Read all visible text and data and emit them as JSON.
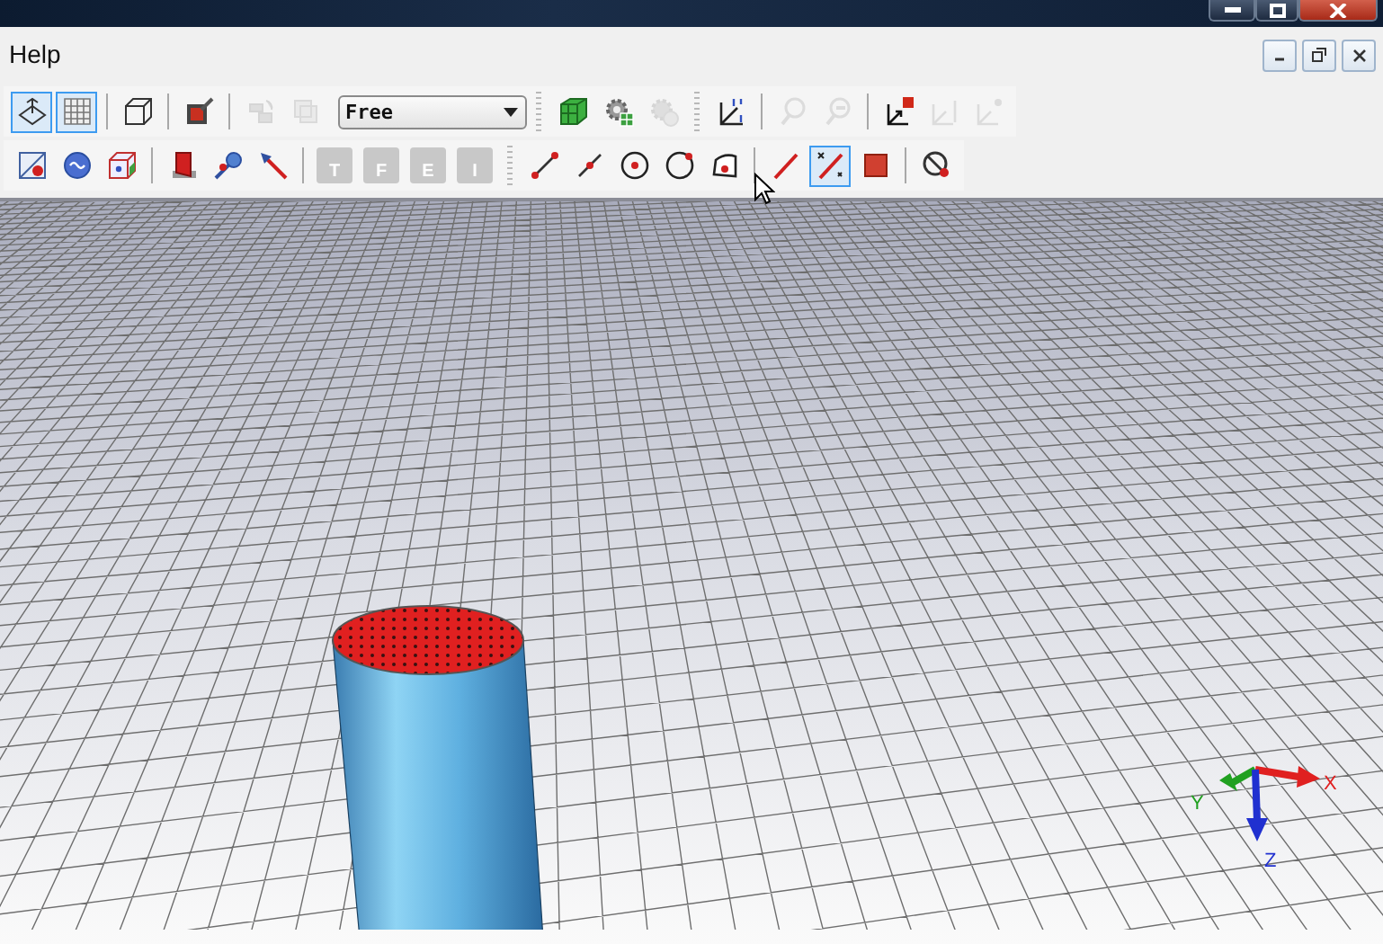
{
  "menu": [
    {
      "label": "Help"
    }
  ],
  "toolbars": [
    {
      "groups": [
        {
          "items": [
            {
              "kind": "workplane",
              "selected": true,
              "disabled": false
            },
            {
              "kind": "grid",
              "selected": true,
              "disabled": false
            }
          ]
        },
        {
          "items": [
            {
              "kind": "wire-cube",
              "selected": false,
              "disabled": false
            }
          ]
        },
        {
          "items": [
            {
              "kind": "paint",
              "selected": false,
              "disabled": false
            }
          ]
        },
        {
          "items": [
            {
              "kind": "transform",
              "selected": false,
              "disabled": true
            },
            {
              "kind": "copy",
              "selected": false,
              "disabled": true
            },
            {
              "kind": "dropdown",
              "value": "Free"
            }
          ]
        },
        {
          "grip": true,
          "items": [
            {
              "kind": "green-cube",
              "selected": false,
              "disabled": false
            },
            {
              "kind": "gear-grid",
              "selected": false,
              "disabled": false
            },
            {
              "kind": "gear-refresh",
              "selected": false,
              "disabled": true
            }
          ]
        },
        {
          "grip": true,
          "items": [
            {
              "kind": "axis-frame",
              "selected": false,
              "disabled": false
            }
          ]
        },
        {
          "items": [
            {
              "kind": "zoom-back",
              "selected": false,
              "disabled": true
            },
            {
              "kind": "zoom-forward",
              "selected": false,
              "disabled": true
            }
          ]
        },
        {
          "items": [
            {
              "kind": "export-point",
              "selected": false,
              "disabled": false
            },
            {
              "kind": "export-bar",
              "selected": false,
              "disabled": true
            },
            {
              "kind": "export-dot",
              "selected": false,
              "disabled": true
            }
          ]
        }
      ]
    },
    {
      "groups": [
        {
          "items": [
            {
              "kind": "plane-split",
              "selected": false,
              "disabled": false
            },
            {
              "kind": "sphere",
              "selected": false,
              "disabled": false
            },
            {
              "kind": "box-dot",
              "selected": false,
              "disabled": false
            }
          ]
        },
        {
          "items": [
            {
              "kind": "door",
              "selected": false,
              "disabled": false
            },
            {
              "kind": "pin-blue",
              "selected": false,
              "disabled": false
            },
            {
              "kind": "pin-red",
              "selected": false,
              "disabled": false
            }
          ]
        },
        {
          "items": [
            {
              "kind": "letter",
              "label": "T",
              "selected": false,
              "disabled": true
            },
            {
              "kind": "letter",
              "label": "F",
              "selected": false,
              "disabled": true
            },
            {
              "kind": "letter",
              "label": "E",
              "selected": false,
              "disabled": true
            },
            {
              "kind": "letter",
              "label": "I",
              "selected": false,
              "disabled": true
            }
          ]
        },
        {
          "grip": true,
          "items": [
            {
              "kind": "segment-two",
              "selected": false,
              "disabled": false
            },
            {
              "kind": "segment-one",
              "selected": false,
              "disabled": false
            },
            {
              "kind": "circle-center",
              "selected": false,
              "disabled": false
            },
            {
              "kind": "circle-arc",
              "selected": false,
              "disabled": false
            },
            {
              "kind": "face",
              "selected": false,
              "disabled": false
            }
          ]
        },
        {
          "items": [
            {
              "kind": "red-line",
              "selected": false,
              "disabled": false
            },
            {
              "kind": "xy-line",
              "selected": true,
              "disabled": false
            },
            {
              "kind": "red-square",
              "selected": false,
              "disabled": false
            }
          ]
        },
        {
          "items": [
            {
              "kind": "no-circle",
              "selected": false,
              "disabled": false
            }
          ]
        }
      ]
    }
  ],
  "viewport": {
    "axes": [
      {
        "label": "X",
        "color": "#e02020"
      },
      {
        "label": "Y",
        "color": "#20a020"
      },
      {
        "label": "Z",
        "color": "#2030d0"
      }
    ]
  }
}
